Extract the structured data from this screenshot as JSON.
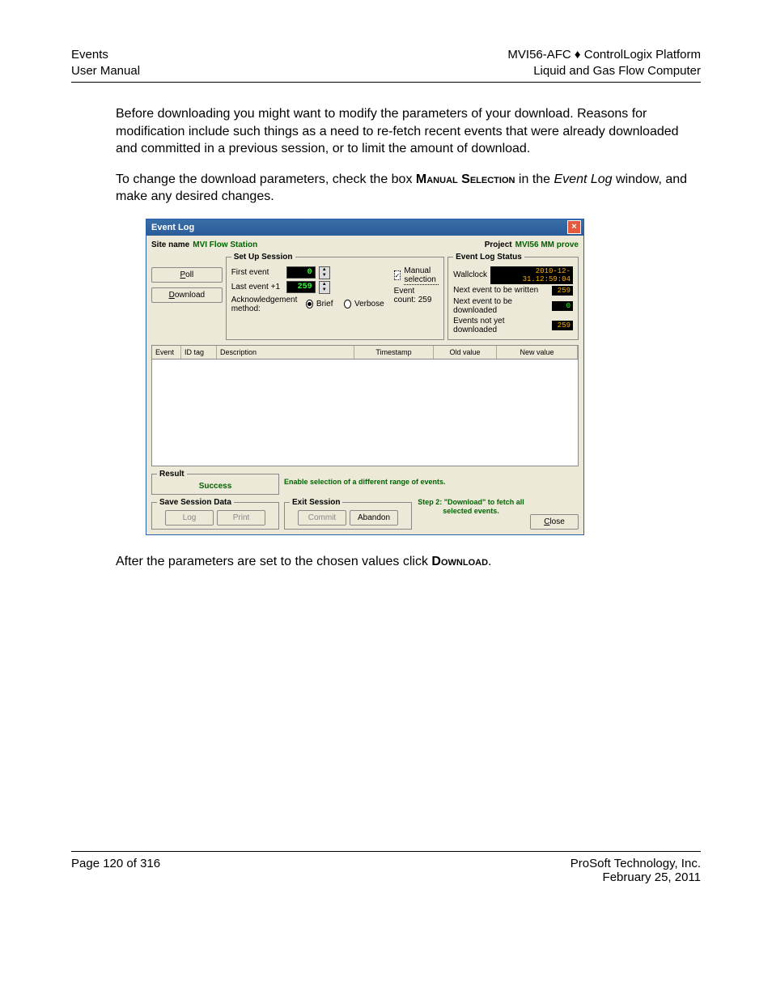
{
  "header": {
    "left1": "Events",
    "left2": "User Manual",
    "right1": "MVI56-AFC ♦ ControlLogix Platform",
    "right2": "Liquid and Gas Flow Computer"
  },
  "para1": "Before downloading you might want to modify the parameters of your download. Reasons for modification include such things as a need to re-fetch recent events that were already downloaded and committed in a previous session, or to limit the amount of download.",
  "para2_a": "To change the download parameters, check the box ",
  "para2_b": "Manual Selection",
  "para2_c": " in the ",
  "para2_d": "Event Log",
  "para2_e": " window, and make any desired changes.",
  "para3_a": "After the parameters are set to the chosen values click ",
  "para3_b": "Download",
  "para3_c": ".",
  "dlg": {
    "title": "Event Log",
    "site_label": "Site name",
    "site_value": "MVI Flow Station",
    "project_label": "Project",
    "project_value": "MVI56 MM prove",
    "poll": "Poll",
    "download": "Download",
    "setup_legend": "Set Up Session",
    "first_event": "First event",
    "first_event_val": "0",
    "last_event": "Last event +1",
    "last_event_val": "259",
    "manual_sel": "Manual selection",
    "event_count": "Event count: 259",
    "ack_method": "Acknowledgement method:",
    "brief": "Brief",
    "verbose": "Verbose",
    "status_legend": "Event Log Status",
    "wallclock_label": "Wallclock",
    "wallclock_val": "2010-12-31.12:59:04",
    "next_write_label": "Next event to be written",
    "next_write_val": "259",
    "next_dl_label": "Next event to be downloaded",
    "next_dl_val": "0",
    "not_dl_label": "Events not yet downloaded",
    "not_dl_val": "259",
    "cols": {
      "event": "Event",
      "idtag": "ID tag",
      "desc": "Description",
      "timestamp": "Timestamp",
      "oldval": "Old value",
      "newval": "New value"
    },
    "result_legend": "Result",
    "result_msg": "Success",
    "result_hint": "Enable selection of a different range of events.",
    "save_legend": "Save Session Data",
    "log": "Log",
    "print": "Print",
    "exit_legend": "Exit Session",
    "commit": "Commit",
    "abandon": "Abandon",
    "step_hint": "Step 2: \"Download\" to fetch all selected events.",
    "close": "Close"
  },
  "footer": {
    "left": "Page 120 of 316",
    "right1": "ProSoft Technology, Inc.",
    "right2": "February 25, 2011"
  }
}
